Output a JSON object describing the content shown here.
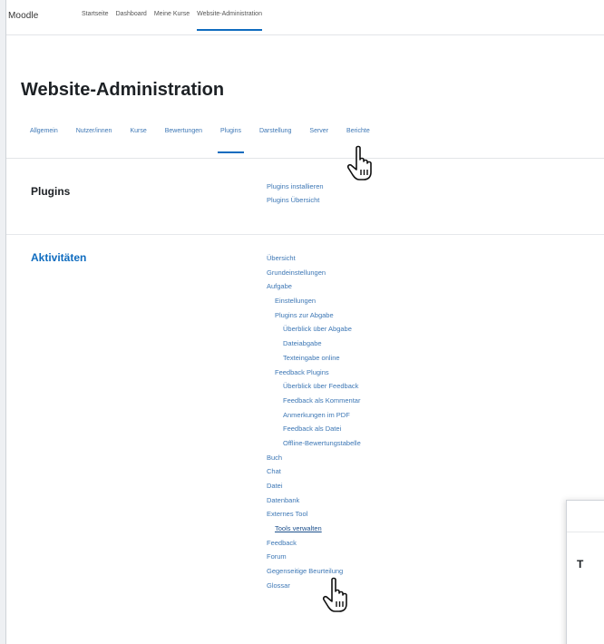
{
  "navbar": {
    "brand": "Moodle",
    "links": [
      "Startseite",
      "Dashboard",
      "Meine Kurse",
      "Website-Administration"
    ],
    "active_index": 3
  },
  "page_title": "Website-Administration",
  "tabs": {
    "items": [
      "Allgemein",
      "Nutzer/innen",
      "Kurse",
      "Bewertungen",
      "Plugins",
      "Darstellung",
      "Server",
      "Berichte"
    ],
    "active_index": 4
  },
  "plugins_section": {
    "title": "Plugins",
    "subtitle": "",
    "links": [
      "Plugins installieren",
      "Plugins Übersicht"
    ]
  },
  "activities_section": {
    "title": "Aktivitäten",
    "links": [
      {
        "label": "Übersicht",
        "level": 0
      },
      {
        "label": "Grundeinstellungen",
        "level": 0
      },
      {
        "label": "Aufgabe",
        "level": 0
      },
      {
        "label": "Einstellungen",
        "level": 1
      },
      {
        "label": "Plugins zur Abgabe",
        "level": 1
      },
      {
        "label": "Überblick über Abgabe",
        "level": 2
      },
      {
        "label": "Dateiabgabe",
        "level": 2
      },
      {
        "label": "Texteingabe online",
        "level": 2
      },
      {
        "label": "Feedback Plugins",
        "level": 1
      },
      {
        "label": "Überblick über Feedback",
        "level": 2
      },
      {
        "label": "Feedback als Kommentar",
        "level": 2
      },
      {
        "label": "Anmerkungen im PDF",
        "level": 2
      },
      {
        "label": "Feedback als Datei",
        "level": 2
      },
      {
        "label": "Offline-Bewertungstabelle",
        "level": 2
      },
      {
        "label": "Buch",
        "level": 0
      },
      {
        "label": "Chat",
        "level": 0
      },
      {
        "label": "Datei",
        "level": 0
      },
      {
        "label": "Datenbank",
        "level": 0
      },
      {
        "label": "Externes Tool",
        "level": 0
      },
      {
        "label": "Tools verwalten",
        "level": 1
      },
      {
        "label": "Feedback",
        "level": 0
      },
      {
        "label": "Forum",
        "level": 0
      },
      {
        "label": "Gegenseitige Beurteilung",
        "level": 0
      },
      {
        "label": "Glossar",
        "level": 0
      }
    ],
    "highlighted_link": "Tools verwalten"
  },
  "dialog": {
    "letter": "T"
  },
  "cursors": [
    "hand-pointer-icon",
    "hand-pointer-icon"
  ],
  "colors": {
    "link": "#3d77b5",
    "accent": "#0f6cbf",
    "heading": "#1d2125"
  }
}
